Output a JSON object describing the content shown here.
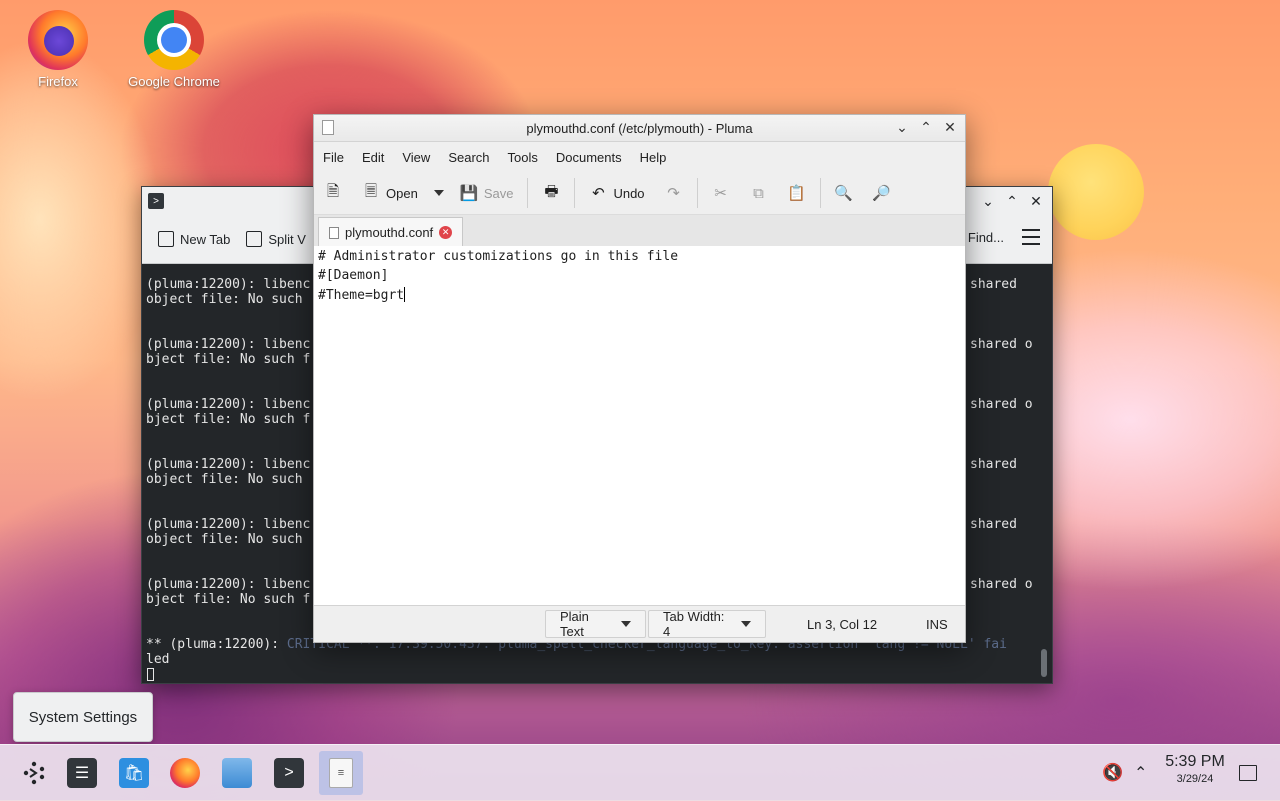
{
  "desktop": {
    "icons": [
      {
        "label": "Firefox",
        "icon": "firefox-icon"
      },
      {
        "label": "Google Chrome",
        "icon": "chrome-icon"
      }
    ]
  },
  "terminal": {
    "toolbar": {
      "new_tab": "New Tab",
      "split_view": "Split V",
      "find": "Find..."
    },
    "lines": [
      {
        "left1": "(pluma:12200): libenc",
        "right1": "shared",
        "left2": "object file: No such"
      },
      {
        "left1": "(pluma:12200): libenc",
        "right1": "shared o",
        "left2": "bject file: No such f"
      },
      {
        "left1": "(pluma:12200): libenc",
        "right1": "shared o",
        "left2": "bject file: No such f"
      },
      {
        "left1": "(pluma:12200): libenc",
        "right1": "shared",
        "left2": "object file: No such"
      },
      {
        "left1": "(pluma:12200): libenc",
        "right1": "shared",
        "left2": "object file: No such"
      },
      {
        "left1": "(pluma:12200): libenc",
        "right1": "shared o",
        "left2": "bject file: No such f"
      }
    ],
    "last_line_prefix": "** (pluma:12200): ",
    "last_line_critical": "CRITICAL **: 17:39:50.437:",
    "last_line_suffix": " pluma_spell_checker_language_to_key: assertion 'lang != NULL' fai",
    "last_line_wrap": "led"
  },
  "pluma": {
    "title": "plymouthd.conf (/etc/plymouth) - Pluma",
    "menu": [
      "File",
      "Edit",
      "View",
      "Search",
      "Tools",
      "Documents",
      "Help"
    ],
    "toolbar": {
      "open": "Open",
      "save": "Save",
      "undo": "Undo"
    },
    "tab": {
      "label": "plymouthd.conf"
    },
    "editor_lines": [
      "# Administrator customizations go in this file",
      "#[Daemon]",
      "#Theme=bgrt"
    ],
    "status": {
      "language": "Plain Text",
      "tab_width": "Tab Width:  4",
      "position": "Ln 3, Col 12",
      "mode": "INS"
    }
  },
  "tooltip": {
    "text": "System Settings"
  },
  "taskbar": {
    "clock_time": "5:39 PM",
    "clock_date": "3/29/24"
  }
}
